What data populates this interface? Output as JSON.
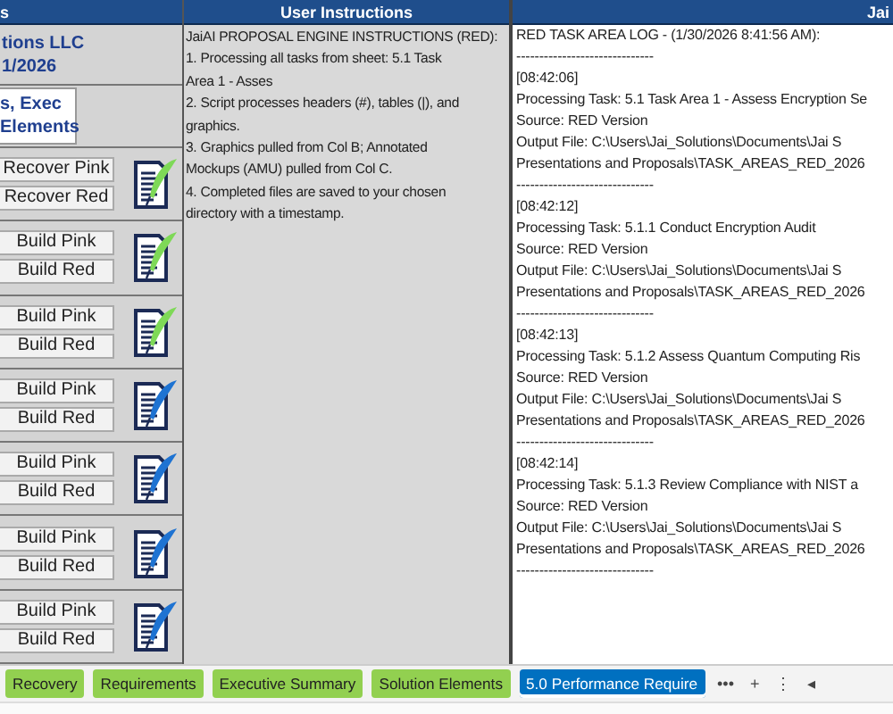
{
  "left_panel": {
    "header": "s",
    "company_lines": [
      "tions LLC",
      "1/2026"
    ],
    "nav_button": [
      "s,  Exec",
      "Elements"
    ],
    "groups": [
      {
        "buttons": [
          "Recover Pink",
          "Recover Red"
        ],
        "color": "#7ed957"
      },
      {
        "buttons": [
          "Build Pink",
          "Build Red"
        ],
        "color": "#7ed957"
      },
      {
        "buttons": [
          "Build Pink",
          "Build Red"
        ],
        "color": "#7ed957"
      },
      {
        "buttons": [
          "Build Pink",
          "Build Red"
        ],
        "color": "#1e73d2"
      },
      {
        "buttons": [
          "Build Pink",
          "Build Red"
        ],
        "color": "#1e73d2"
      },
      {
        "buttons": [
          "Build Pink",
          "Build Red"
        ],
        "color": "#1e73d2"
      },
      {
        "buttons": [
          "Build Pink",
          "Build Red"
        ],
        "color": "#1e73d2"
      }
    ]
  },
  "instructions": {
    "header": "User Instructions",
    "lines": [
      "JaiAI PROPOSAL ENGINE INSTRUCTIONS (RED):",
      "1. Processing all tasks from sheet: 5.1 Task",
      "Area 1 - Asses",
      "2. Script processes headers (#), tables (|), and",
      "graphics.",
      "3. Graphics pulled from Col B; Annotated",
      "Mockups (AMU) pulled from Col C.",
      "4. Completed files are saved to your chosen",
      "directory with a timestamp."
    ]
  },
  "log": {
    "header": "Jai",
    "lines": [
      "RED TASK AREA LOG - (1/30/2026 8:41:56 AM):",
      "------------------------------",
      "[08:42:06]",
      "Processing Task: 5.1 Task Area 1 - Assess Encryption Se",
      "Source: RED Version",
      "Output File: C:\\Users\\Jai_Solutions\\Documents\\Jai S",
      "Presentations and Proposals\\TASK_AREAS_RED_2026",
      "------------------------------",
      "[08:42:12]",
      "Processing Task: 5.1.1 Conduct Encryption Audit",
      "Source: RED Version",
      "Output File: C:\\Users\\Jai_Solutions\\Documents\\Jai S",
      "Presentations and Proposals\\TASK_AREAS_RED_2026",
      "------------------------------",
      "[08:42:13]",
      "Processing Task: 5.1.2 Assess Quantum Computing Ris",
      "Source: RED Version",
      "Output File: C:\\Users\\Jai_Solutions\\Documents\\Jai S",
      "Presentations and Proposals\\TASK_AREAS_RED_2026",
      "------------------------------",
      "[08:42:14]",
      "Processing Task: 5.1.3 Review Compliance with NIST a",
      "Source: RED Version",
      "Output File: C:\\Users\\Jai_Solutions\\Documents\\Jai S",
      "Presentations and Proposals\\TASK_AREAS_RED_2026",
      "------------------------------"
    ]
  },
  "sheet_tabs": [
    {
      "label": "Recovery",
      "color": "#92d050",
      "selected": false
    },
    {
      "label": "Requirements",
      "color": "#92d050",
      "selected": false
    },
    {
      "label": "Executive Summary",
      "color": "#92d050",
      "selected": false
    },
    {
      "label": "Solution Elements",
      "color": "#92d050",
      "selected": false
    },
    {
      "label": "5.0 Performance Require",
      "color": "#0070c0",
      "selected": true
    }
  ],
  "tab_controls": [
    "•••",
    "+",
    "⋮",
    "◂"
  ]
}
